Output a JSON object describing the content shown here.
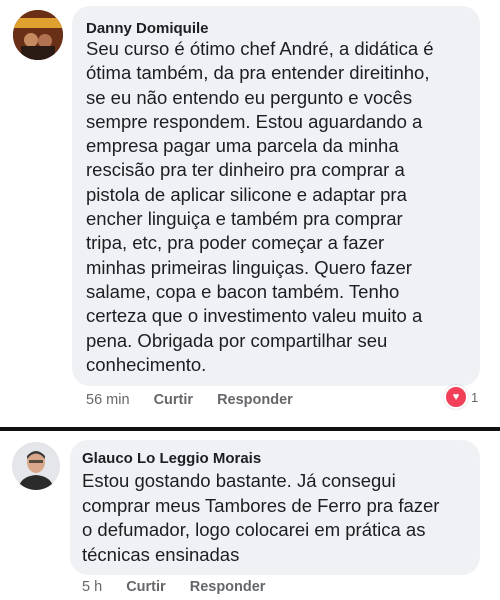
{
  "comments": [
    {
      "author": "Danny Domiquile",
      "lines": [
        "Seu curso é ótimo chef André, a didática é",
        "ótima também, da pra entender direitinho,",
        "se eu não entendo eu pergunto e vocês",
        "sempre respondem. Estou aguardando a",
        "empresa pagar uma parcela da minha",
        "rescisão pra ter dinheiro pra comprar a",
        "pistola de aplicar silicone e adaptar pra",
        "encher linguiça e também pra comprar",
        "tripa, etc, pra poder começar a fazer",
        "minhas primeiras linguiças. Quero fazer",
        "salame, copa e bacon também. Tenho",
        "certeza que o investimento valeu muito a",
        "pena. Obrigada por compartilhar seu",
        "conhecimento."
      ],
      "time": "56 min",
      "like_label": "Curtir",
      "reply_label": "Responder",
      "reaction": {
        "icon": "heart-icon",
        "count": "1",
        "color": "#f33e58"
      }
    },
    {
      "author": "Glauco Lo Leggio Morais",
      "lines": [
        "Estou gostando bastante. Já consegui",
        "comprar meus Tambores de Ferro pra fazer",
        "o defumador, logo colocarei em prática as",
        "técnicas ensinadas"
      ],
      "time": "5 h",
      "like_label": "Curtir",
      "reply_label": "Responder"
    }
  ],
  "colors": {
    "bubble": "#eff1f4",
    "meta_text": "#65676b",
    "divider": "#111111"
  }
}
